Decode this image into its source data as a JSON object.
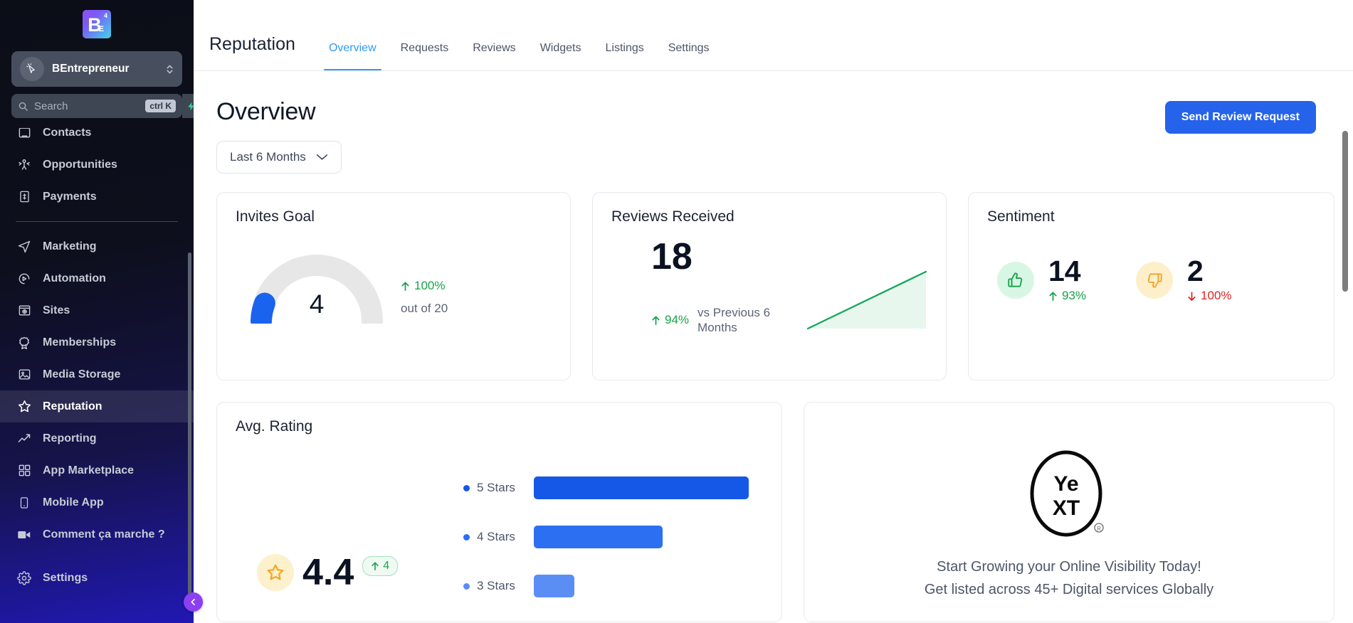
{
  "sidebar": {
    "logo": {
      "main": "B",
      "sub": "E",
      "sup": "4",
      "name": "brand-logo"
    },
    "account": {
      "name": "BEntrepreneur"
    },
    "search": {
      "placeholder": "Search",
      "shortcut": "ctrl K"
    },
    "items": [
      {
        "label": "Contacts",
        "icon": "contacts-icon",
        "active": false
      },
      {
        "label": "Opportunities",
        "icon": "opportunities-icon",
        "active": false
      },
      {
        "label": "Payments",
        "icon": "payments-icon",
        "active": false
      },
      {
        "label": "Marketing",
        "icon": "marketing-icon",
        "active": false
      },
      {
        "label": "Automation",
        "icon": "automation-icon",
        "active": false
      },
      {
        "label": "Sites",
        "icon": "sites-icon",
        "active": false
      },
      {
        "label": "Memberships",
        "icon": "memberships-icon",
        "active": false
      },
      {
        "label": "Media Storage",
        "icon": "media-storage-icon",
        "active": false
      },
      {
        "label": "Reputation",
        "icon": "reputation-star-icon",
        "active": true
      },
      {
        "label": "Reporting",
        "icon": "reporting-trend-icon",
        "active": false
      },
      {
        "label": "App Marketplace",
        "icon": "app-marketplace-icon",
        "active": false
      },
      {
        "label": "Mobile App",
        "icon": "mobile-app-icon",
        "active": false
      },
      {
        "label": "Comment ça marche ?",
        "icon": "video-camera-icon",
        "active": false
      },
      {
        "label": "Settings",
        "icon": "gear-icon",
        "active": false
      }
    ]
  },
  "header": {
    "title": "Reputation",
    "tabs": [
      {
        "label": "Overview",
        "active": true
      },
      {
        "label": "Requests",
        "active": false
      },
      {
        "label": "Reviews",
        "active": false
      },
      {
        "label": "Widgets",
        "active": false
      },
      {
        "label": "Listings",
        "active": false
      },
      {
        "label": "Settings",
        "active": false
      }
    ]
  },
  "overview": {
    "title": "Overview",
    "date_range": "Last 6 Months",
    "primary_button": "Send Review Request"
  },
  "cards": {
    "invites_goal": {
      "title": "Invites Goal",
      "value": "4",
      "delta": "100%",
      "delta_direction": "up",
      "out_of": "out of 20",
      "goal_total": 20,
      "percent_filled": 20
    },
    "reviews_received": {
      "title": "Reviews Received",
      "value": "18",
      "delta": "94%",
      "delta_direction": "up",
      "comparison": "vs Previous 6 Months"
    },
    "sentiment": {
      "title": "Sentiment",
      "positive": {
        "icon": "thumbs-up-icon",
        "value": "14",
        "delta": "93%",
        "delta_direction": "up"
      },
      "negative": {
        "icon": "thumbs-down-icon",
        "value": "2",
        "delta": "100%",
        "delta_direction": "down"
      }
    },
    "avg_rating": {
      "title": "Avg. Rating",
      "value": "4.4",
      "chip": "4",
      "chip_direction": "up"
    },
    "yext": {
      "logo_top": "Ye",
      "logo_bottom": "XT",
      "line1": "Start Growing your Online Visibility Today!",
      "line2": "Get listed across 45+ Digital services Globally"
    }
  },
  "chart_data": {
    "type": "bar",
    "title": "Avg. Rating",
    "orientation": "horizontal",
    "categories": [
      "5 Stars",
      "4 Stars",
      "3 Stars"
    ],
    "values": [
      100,
      60,
      19
    ],
    "colors": [
      "#1558e8",
      "#2c6ff0",
      "#5b8ef5"
    ],
    "xlabel": "",
    "ylabel": "",
    "xlim": [
      0,
      100
    ],
    "grid": false,
    "legend": "inline-left-dots",
    "average": 4.4
  },
  "colors": {
    "accent_blue": "#2563eb",
    "tab_active": "#2f9bf5",
    "success_green": "#17a34a",
    "danger_red": "#e02424",
    "warning_amber": "#f5a623",
    "sidebar_dark": "#0b0d17"
  }
}
